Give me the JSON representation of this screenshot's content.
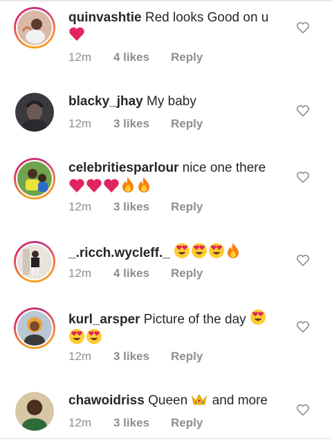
{
  "comments": [
    {
      "username": "quinvashtie",
      "text": "Red looks Good on u",
      "emoji": "❤",
      "time": "12m",
      "likes": "4 likes",
      "reply": "Reply"
    },
    {
      "username": "blacky_jhay",
      "text": "My baby",
      "emoji": "",
      "time": "12m",
      "likes": "3 likes",
      "reply": "Reply"
    },
    {
      "username": "celebritiesparlour",
      "text": "nice one there",
      "emoji": "❤❤❤🔥🔥",
      "time": "12m",
      "likes": "3 likes",
      "reply": "Reply"
    },
    {
      "username": "_.ricch.wycleff._",
      "text": "",
      "emoji": "😍😍😍🔥",
      "time": "12m",
      "likes": "4 likes",
      "reply": "Reply"
    },
    {
      "username": "kurl_arsper",
      "text": "Picture of the day",
      "emoji": "😍😍😍",
      "time": "12m",
      "likes": "3 likes",
      "reply": "Reply"
    },
    {
      "username": "chawoidriss",
      "text": "Queen",
      "emoji": "👑",
      "text_after": "and more",
      "time": "12m",
      "likes": "3 likes",
      "reply": "Reply"
    }
  ],
  "colors": {
    "primary_text": "#262626",
    "secondary_text": "#8e8e8e",
    "heart_emoji": "#e0245e",
    "story_ring": "#e1306c"
  },
  "icons": {
    "like": "heart-outline-icon"
  }
}
